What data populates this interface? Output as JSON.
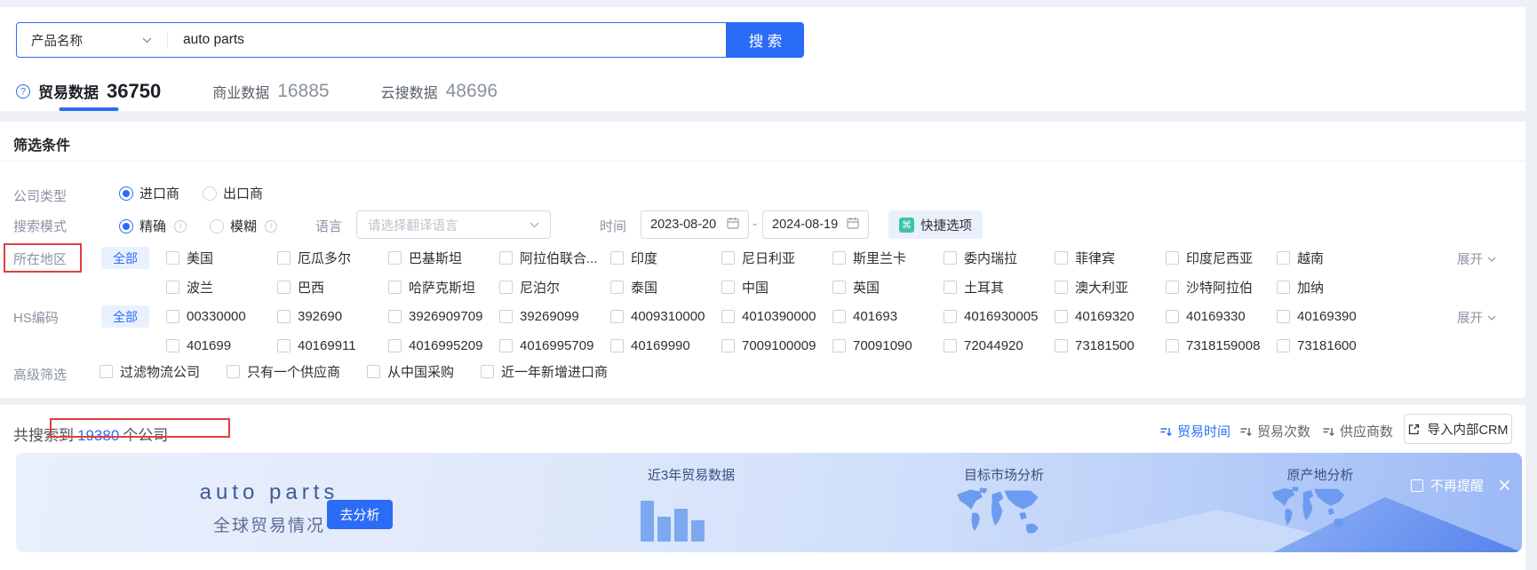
{
  "search": {
    "category": "产品名称",
    "query": "auto parts",
    "button": "搜 索"
  },
  "tabs": [
    {
      "label": "贸易数据",
      "count": "36750",
      "active": true
    },
    {
      "label": "商业数据",
      "count": "16885",
      "active": false
    },
    {
      "label": "云搜数据",
      "count": "48696",
      "active": false
    }
  ],
  "filter": {
    "title": "筛选条件",
    "company_type": {
      "label": "公司类型",
      "options": [
        "进口商",
        "出口商"
      ],
      "selected": "进口商"
    },
    "search_mode": {
      "label": "搜索模式",
      "options": [
        "精确",
        "模糊"
      ],
      "selected": "精确"
    },
    "language": {
      "label": "语言",
      "placeholder": "请选择翻译语言"
    },
    "time": {
      "label": "时间",
      "start": "2023-08-20",
      "end": "2024-08-19",
      "separator": "-"
    },
    "quick_option": "快捷选项",
    "region": {
      "label": "所在地区",
      "all": "全部",
      "expand": "展开",
      "row1": [
        "美国",
        "厄瓜多尔",
        "巴基斯坦",
        "阿拉伯联合...",
        "印度",
        "尼日利亚",
        "斯里兰卡",
        "委内瑞拉",
        "菲律宾",
        "印度尼西亚",
        "越南"
      ],
      "row2": [
        "波兰",
        "巴西",
        "哈萨克斯坦",
        "尼泊尔",
        "泰国",
        "中国",
        "英国",
        "土耳其",
        "澳大利亚",
        "沙特阿拉伯",
        "加纳"
      ]
    },
    "hs_code": {
      "label": "HS编码",
      "all": "全部",
      "expand": "展开",
      "row1": [
        "00330000",
        "392690",
        "3926909709",
        "39269099",
        "4009310000",
        "4010390000",
        "401693",
        "4016930005",
        "40169320",
        "40169330",
        "40169390"
      ],
      "row2": [
        "401699",
        "40169911",
        "4016995209",
        "4016995709",
        "40169990",
        "7009100009",
        "70091090",
        "72044920",
        "73181500",
        "7318159008",
        "73181600"
      ]
    },
    "advanced": {
      "label": "高级筛选",
      "options": [
        "过滤物流公司",
        "只有一个供应商",
        "从中国采购",
        "近一年新增进口商"
      ]
    }
  },
  "results": {
    "prefix": "共搜索到",
    "count": "19380",
    "suffix": "个公司",
    "sorts": [
      {
        "label": "贸易时间",
        "active": true
      },
      {
        "label": "贸易次数",
        "active": false
      },
      {
        "label": "供应商数",
        "active": false
      }
    ],
    "crm_button": "导入内部CRM"
  },
  "banner": {
    "title": "auto parts",
    "subtitle": "全球贸易情况",
    "analyze_button": "去分析",
    "items": [
      "近3年贸易数据",
      "目标市场分析",
      "原产地分析"
    ],
    "dismiss": "不再提醒"
  },
  "colors": {
    "primary": "#2b6cf6",
    "annotation_red": "#e03e3e",
    "quick_icon_teal": "#3ec3a8",
    "banner_map_blue": "#6d9bf0"
  }
}
